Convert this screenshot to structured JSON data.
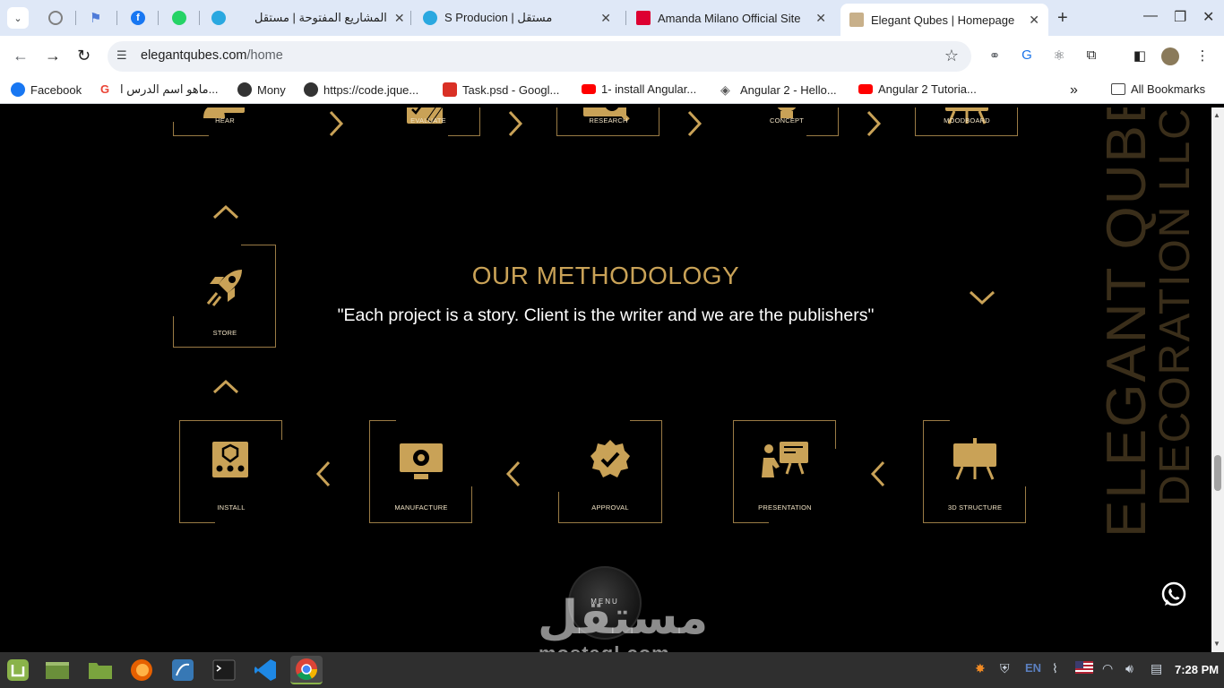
{
  "browser": {
    "tabs": [
      {
        "label": "",
        "icon": "chatgpt-icon",
        "color": "#808080"
      },
      {
        "label": "",
        "icon": "flag-icon",
        "color": "#4f7bd8"
      },
      {
        "label": "",
        "icon": "facebook-icon",
        "color": "#1877f2"
      },
      {
        "label": "",
        "icon": "whatsapp-icon",
        "color": "#25d366"
      },
      {
        "label": "المشاريع المفتوحة | مستقل",
        "icon": "mostaql-icon",
        "color": "#2aa8e0"
      },
      {
        "label": "S Producion | مستقل",
        "icon": "mostaql-icon",
        "color": "#2aa8e0"
      },
      {
        "label": "Amanda Milano Official Site",
        "icon": "angular-icon",
        "color": "#dd0031"
      },
      {
        "label": "Elegant Qubes | Homepage",
        "icon": "site-icon",
        "color": "#c8b08a",
        "active": true
      }
    ],
    "new_tab": "+",
    "url_host": "elegantqubes.com",
    "url_path": "/home",
    "bookmarks": [
      {
        "label": "Facebook",
        "icon": "facebook-icon",
        "color": "#1877f2"
      },
      {
        "label": "ماهو اسم الدرس ا...",
        "icon": "google-icon",
        "color": "#ea4335"
      },
      {
        "label": "Mony",
        "icon": "globe-icon",
        "color": "#333333"
      },
      {
        "label": "https://code.jque...",
        "icon": "globe-icon",
        "color": "#333333"
      },
      {
        "label": "Task.psd - Googl...",
        "icon": "photo-icon",
        "color": "#d93025"
      },
      {
        "label": "1- install Angular...",
        "icon": "youtube-icon",
        "color": "#ff0000"
      },
      {
        "label": "Angular 2 - Hello...",
        "icon": "diamond-icon",
        "color": "#555555"
      },
      {
        "label": "Angular 2 Tutoria...",
        "icon": "youtube-icon",
        "color": "#ff0000"
      }
    ],
    "more": "»",
    "all_bookmarks": "All Bookmarks"
  },
  "page": {
    "top_steps": [
      "HEAR",
      "EVALUATE",
      "RESEARCH",
      "CONCEPT",
      "MOODBOARD"
    ],
    "store_step": "STORE",
    "bottom_steps": [
      "INSTALL",
      "MANUFACTURE",
      "APPROVAL",
      "PRESENTATION",
      "3D STRUCTURE"
    ],
    "title": "OUR METHODOLOGY",
    "subtitle": "\"Each project is a story. Client is the writer and we are the publishers\"",
    "vertical_line1": "ELEGANT QUBES",
    "vertical_line2": "DECORATION LLC",
    "menu_label": "MENU",
    "accent": "#c9a257",
    "watermark_ar": "مستقل",
    "watermark_en": "mostaql.com"
  },
  "taskbar": {
    "lang": "EN",
    "time": "7:28 PM"
  }
}
